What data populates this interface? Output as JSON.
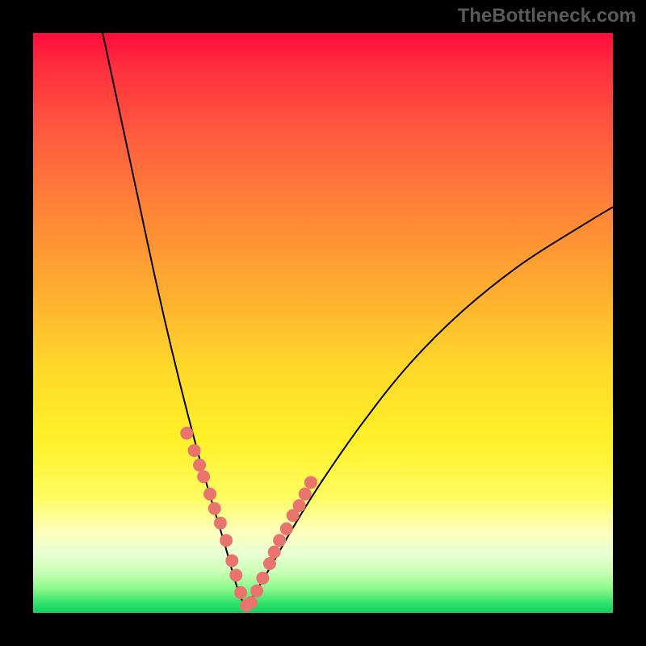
{
  "watermark": "TheBottleneck.com",
  "colors": {
    "frame_bg": "#000000",
    "curve_stroke": "#000000",
    "dot_fill": "#e9746e",
    "gradient_top": "#ff0c3c",
    "gradient_bottom": "#14d060"
  },
  "chart_data": {
    "type": "line",
    "title": "",
    "xlabel": "",
    "ylabel": "",
    "xlim": [
      0,
      100
    ],
    "ylim": [
      0,
      100
    ],
    "grid": false,
    "legend": false,
    "note": "Axes are unlabeled in the image; x/y are treated as percent of plot area with origin at bottom-left. The visible curve is a V-shaped bottleneck curve (two branches). Values are estimated from pixel positions.",
    "series": [
      {
        "name": "left-branch",
        "x": [
          12,
          15,
          18,
          21,
          24,
          27,
          30,
          33,
          35,
          36.5
        ],
        "y": [
          100,
          86,
          72,
          58,
          45,
          33,
          22,
          12,
          5,
          1
        ]
      },
      {
        "name": "right-branch",
        "x": [
          36.5,
          38,
          41,
          45,
          50,
          57,
          65,
          74,
          84,
          95,
          100
        ],
        "y": [
          1,
          3,
          8,
          15,
          23,
          33,
          43,
          52,
          60,
          67,
          70
        ]
      }
    ],
    "scatter_points": {
      "name": "highlighted-dots",
      "note": "Salmon-colored dots clustered near the bottom of the V on both branches.",
      "x": [
        26.5,
        27.8,
        28.7,
        29.4,
        30.5,
        31.3,
        32.3,
        33.3,
        34.3,
        35.0,
        35.8,
        36.8,
        37.6,
        38.6,
        39.6,
        40.8,
        41.6,
        42.5,
        43.7,
        44.8,
        45.9,
        46.9,
        47.9
      ],
      "y": [
        31.0,
        28.0,
        25.5,
        23.5,
        20.5,
        18.0,
        15.5,
        12.5,
        9.0,
        6.5,
        3.5,
        1.3,
        1.8,
        3.8,
        6.0,
        8.5,
        10.5,
        12.5,
        14.5,
        16.8,
        18.5,
        20.5,
        22.5
      ]
    }
  }
}
